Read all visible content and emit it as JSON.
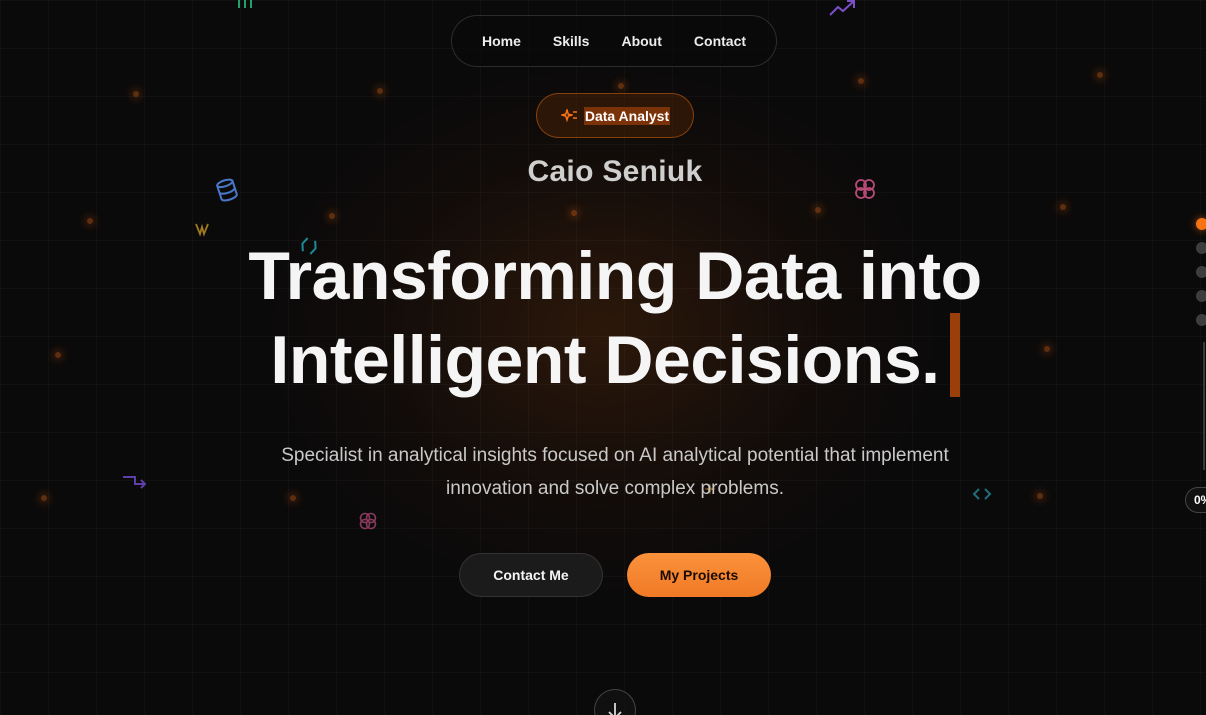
{
  "nav": {
    "items": [
      {
        "label": "Home"
      },
      {
        "label": "Skills"
      },
      {
        "label": "About"
      },
      {
        "label": "Contact"
      }
    ]
  },
  "hero": {
    "badge": {
      "label": "Data Analyst",
      "icon": "sparkle-icon"
    },
    "name": "Caio Seniuk",
    "headline_line1": "Transforming Data into",
    "headline_line2": "Intelligent Decisions.",
    "subtitle_line1": "Specialist in analytical insights focused on AI analytical potential that implement",
    "subtitle_line2": "innovation and solve complex problems.",
    "buttons": {
      "contact": "Contact Me",
      "projects": "My Projects"
    }
  },
  "side_nav": {
    "sections": 5,
    "active_index": 0,
    "progress_label": "0%"
  },
  "colors": {
    "accent": "#f97316",
    "background": "#0b0a0a",
    "text": "#f5f5f5"
  },
  "decor_icons": [
    "bar-chart-icon",
    "trend-up-icon",
    "database-icon",
    "brain-icon",
    "spark-icon",
    "cube-icon",
    "arrow-turn-icon",
    "code-icon"
  ]
}
